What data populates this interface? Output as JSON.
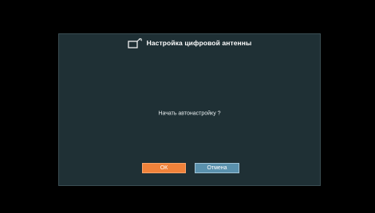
{
  "dialog": {
    "title": "Настройка цифровой антенны",
    "title_icon": "tv-antenna-icon",
    "message": "Начать автонастройку ?",
    "buttons": {
      "ok_label": "ОК",
      "cancel_label": "Отмена"
    }
  },
  "colors": {
    "background": "#000000",
    "dialog_background": "#1f3035",
    "ok_button": "#f0823a",
    "cancel_button": "#5a91ad"
  }
}
